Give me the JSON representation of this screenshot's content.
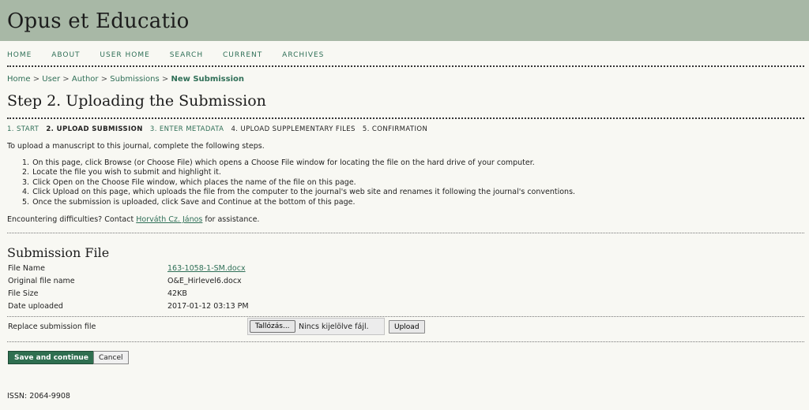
{
  "site": {
    "title": "Opus et Educatio"
  },
  "nav": {
    "items": [
      "HOME",
      "ABOUT",
      "USER HOME",
      "SEARCH",
      "CURRENT",
      "ARCHIVES"
    ]
  },
  "breadcrumb": {
    "home": "Home",
    "user": "User",
    "author": "Author",
    "submissions": "Submissions",
    "current": "New Submission",
    "separator": ">"
  },
  "page_title": "Step 2. Uploading the Submission",
  "steps": [
    {
      "label": "1. START",
      "state": "link"
    },
    {
      "label": "2. UPLOAD SUBMISSION",
      "state": "active"
    },
    {
      "label": "3. ENTER METADATA",
      "state": "link"
    },
    {
      "label": "4. UPLOAD SUPPLEMENTARY FILES",
      "state": "plain"
    },
    {
      "label": "5. CONFIRMATION",
      "state": "plain"
    }
  ],
  "intro": "To upload a manuscript to this journal, complete the following steps.",
  "instructions": [
    {
      "num": "1.",
      "text": "On this page, click Browse (or Choose File) which opens a Choose File window for locating the file on the hard drive of your computer."
    },
    {
      "num": "2.",
      "text": "Locate the file you wish to submit and highlight it."
    },
    {
      "num": "3.",
      "text": "Click Open on the Choose File window, which places the name of the file on this page."
    },
    {
      "num": "4.",
      "text": "Click Upload on this page, which uploads the file from the computer to the journal's web site and renames it following the journal's conventions."
    },
    {
      "num": "5.",
      "text": "Once the submission is uploaded, click Save and Continue at the bottom of this page."
    }
  ],
  "difficulty": {
    "prefix": "Encountering difficulties? Contact ",
    "contact": "Horváth Cz. János",
    "suffix": " for assistance."
  },
  "submission_file": {
    "title": "Submission File",
    "file_name_label": "File Name",
    "file_name": "163-1058-1-SM.docx",
    "original_label": "Original file name",
    "original": "O&E_Hirlevel6.docx",
    "size_label": "File Size",
    "size": "42KB",
    "date_label": "Date uploaded",
    "date": "2017-01-12 03:13 PM"
  },
  "replace": {
    "label": "Replace submission file",
    "browse_label": "Tallózás...",
    "no_file": "Nincs kijelölve fájl.",
    "upload_label": "Upload"
  },
  "actions": {
    "save_label": "Save and continue",
    "cancel_label": "Cancel"
  },
  "footer": {
    "issn": "ISSN: 2064-9908"
  },
  "colors": {
    "header_bg": "#a8b8a6",
    "link": "#2f6f57",
    "primary_button": "#2f6f50",
    "page_bg": "#f8f8f3"
  }
}
